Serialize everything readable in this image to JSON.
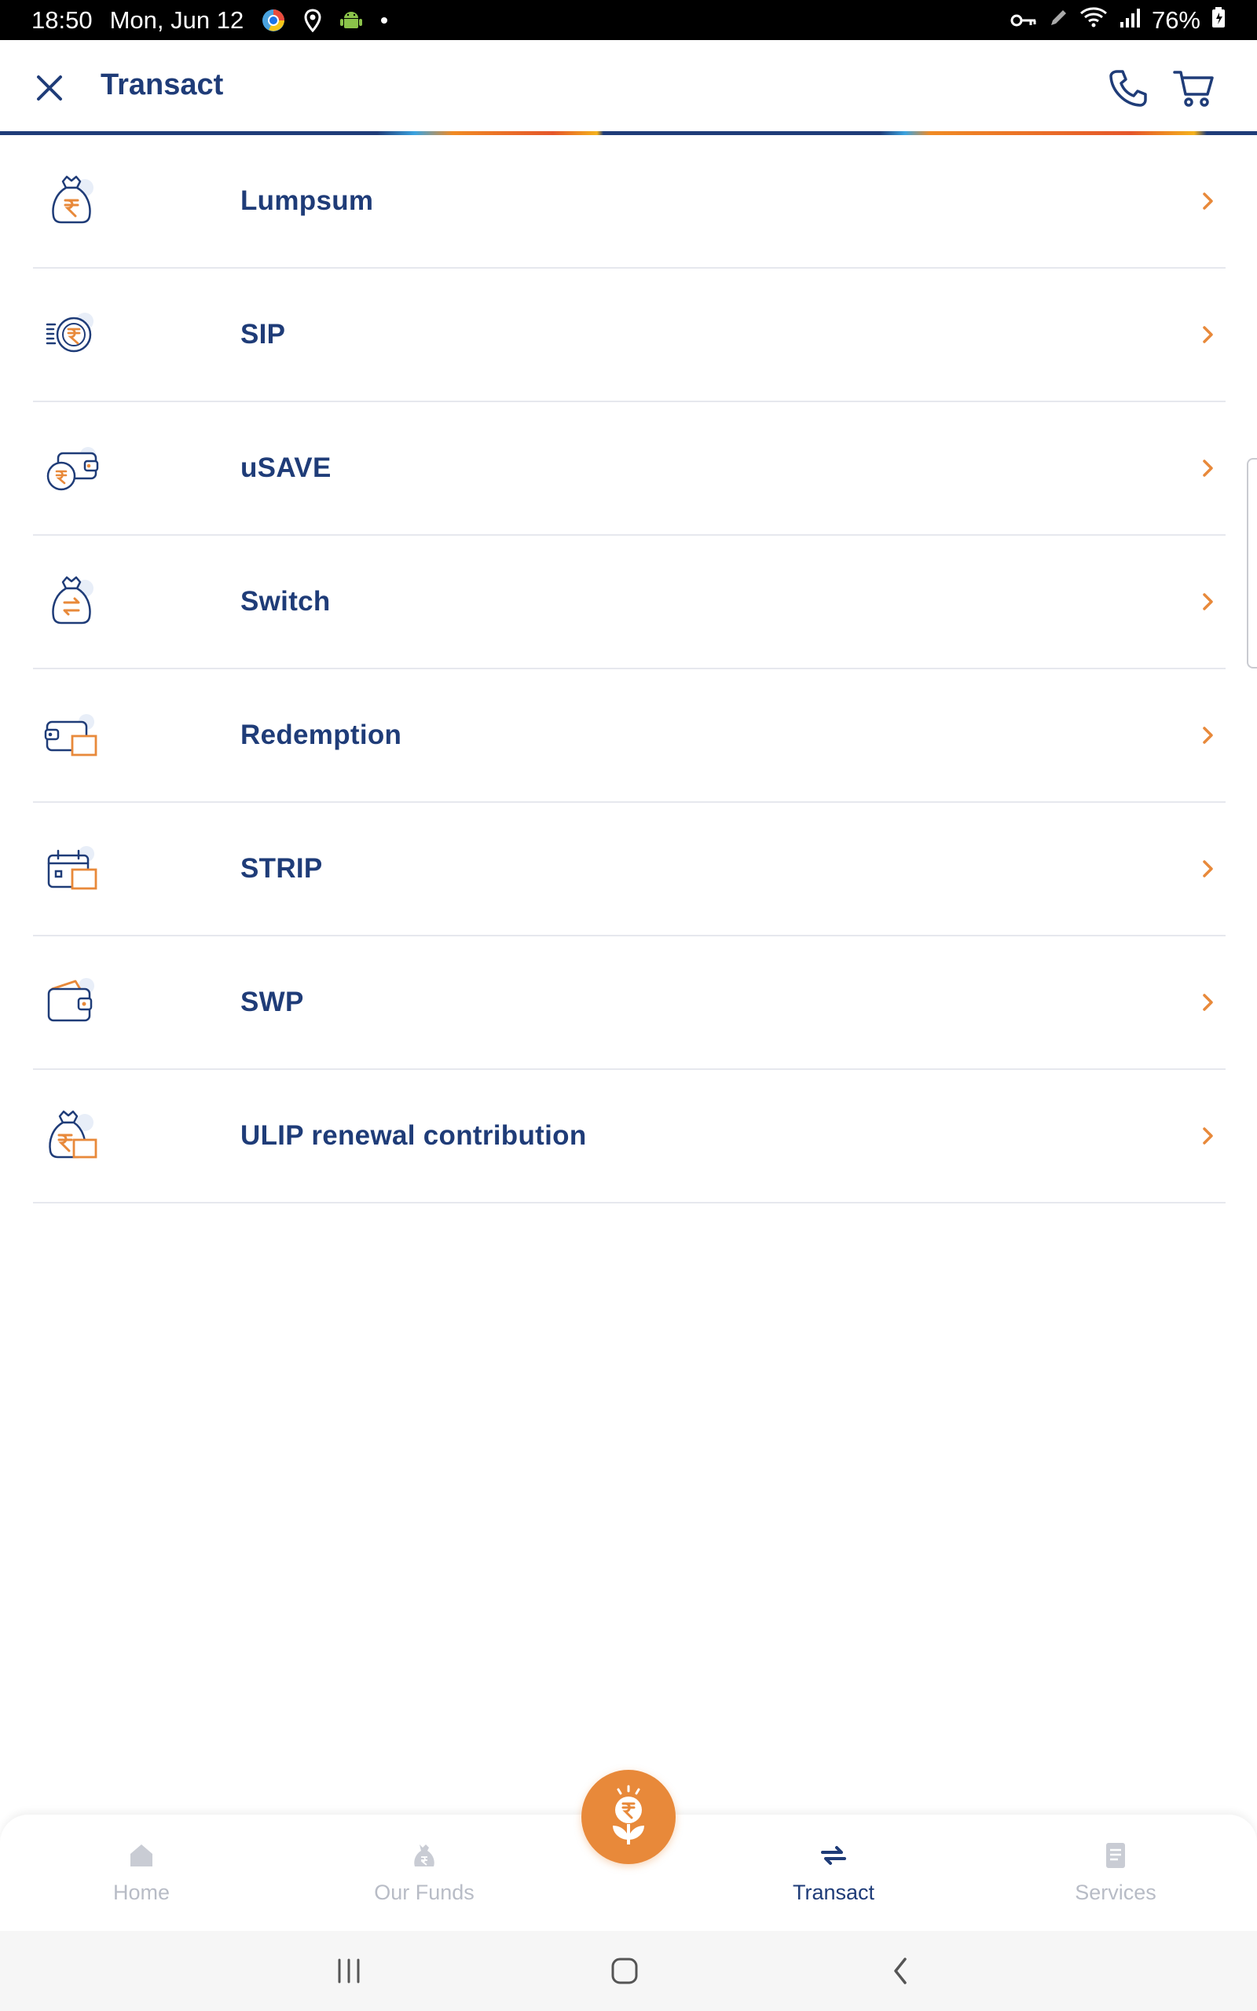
{
  "status_bar": {
    "time": "18:50",
    "date": "Mon, Jun 12",
    "battery": "76%"
  },
  "header": {
    "title": "Transact"
  },
  "menu": [
    {
      "label": "Lumpsum",
      "icon": "money-bag-rupee-icon"
    },
    {
      "label": "SIP",
      "icon": "sip-coin-icon"
    },
    {
      "label": "uSAVE",
      "icon": "wallet-coin-icon"
    },
    {
      "label": "Switch",
      "icon": "money-bag-switch-icon"
    },
    {
      "label": "Redemption",
      "icon": "wallet-redeem-icon"
    },
    {
      "label": "STRIP",
      "icon": "calendar-icon"
    },
    {
      "label": "SWP",
      "icon": "wallet-icon"
    },
    {
      "label": "ULIP renewal contribution",
      "icon": "money-bag-renew-icon"
    }
  ],
  "bottom_nav": {
    "items": [
      {
        "label": "Home",
        "icon": "home-icon",
        "active": false
      },
      {
        "label": "Our Funds",
        "icon": "funds-bag-icon",
        "active": false
      },
      {
        "label": "Transact",
        "icon": "transfer-arrows-icon",
        "active": true
      },
      {
        "label": "Services",
        "icon": "document-icon",
        "active": false
      }
    ],
    "fab_icon": "rupee-plant-icon"
  },
  "colors": {
    "primary": "#1f3c78",
    "accent": "#e8893a",
    "inactive": "#b8bcc6",
    "divider": "#e6e8ee"
  }
}
